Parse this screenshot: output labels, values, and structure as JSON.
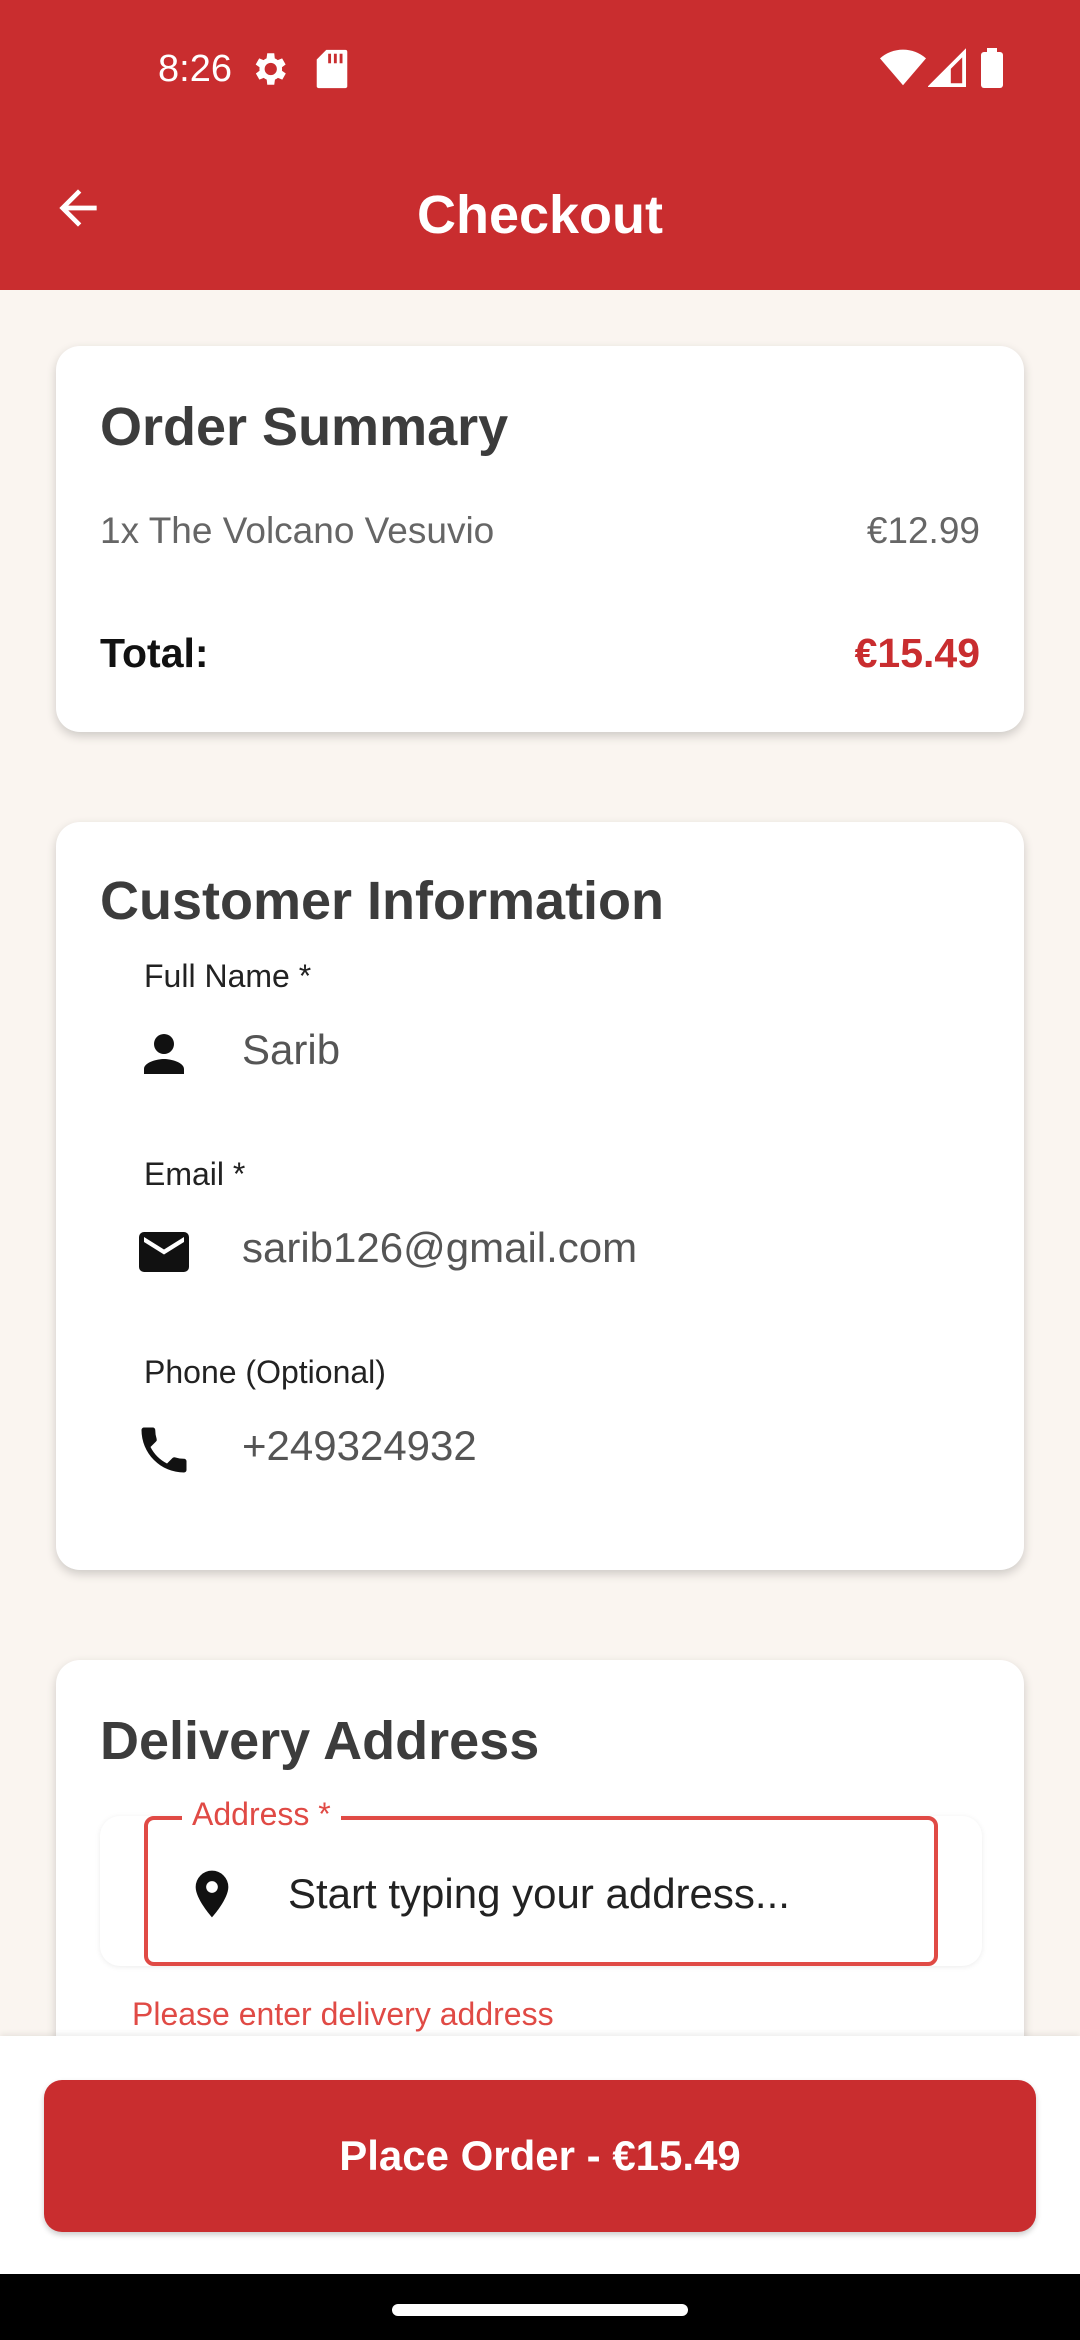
{
  "status_bar": {
    "time": "8:26",
    "icons": [
      "settings-gear-icon",
      "sd-card-icon",
      "wifi-icon",
      "cell-signal-icon",
      "battery-icon"
    ]
  },
  "app_bar": {
    "title": "Checkout",
    "back_icon": "arrow-back-icon"
  },
  "order_summary": {
    "title": "Order Summary",
    "items": [
      {
        "name": "1x The Volcano Vesuvio",
        "price": "€12.99"
      }
    ],
    "total_label": "Total:",
    "total_value": "€15.49"
  },
  "customer_info": {
    "title": "Customer Information",
    "fields": [
      {
        "label": "Full Name *",
        "value": "Sarib",
        "icon": "person-icon"
      },
      {
        "label": "Email *",
        "value": "sarib126@gmail.com",
        "icon": "mail-icon"
      },
      {
        "label": "Phone (Optional)",
        "value": "+249324932",
        "icon": "phone-icon"
      }
    ]
  },
  "delivery": {
    "title": "Delivery Address",
    "address_label": "Address *",
    "address_placeholder": "Start typing your address...",
    "address_icon": "location-pin-icon",
    "error": "Please enter delivery address"
  },
  "footer": {
    "place_order_label": "Place Order - €15.49"
  },
  "colors": {
    "primary": "#c92d2f",
    "error": "#e04a45",
    "background": "#faf5f0"
  }
}
